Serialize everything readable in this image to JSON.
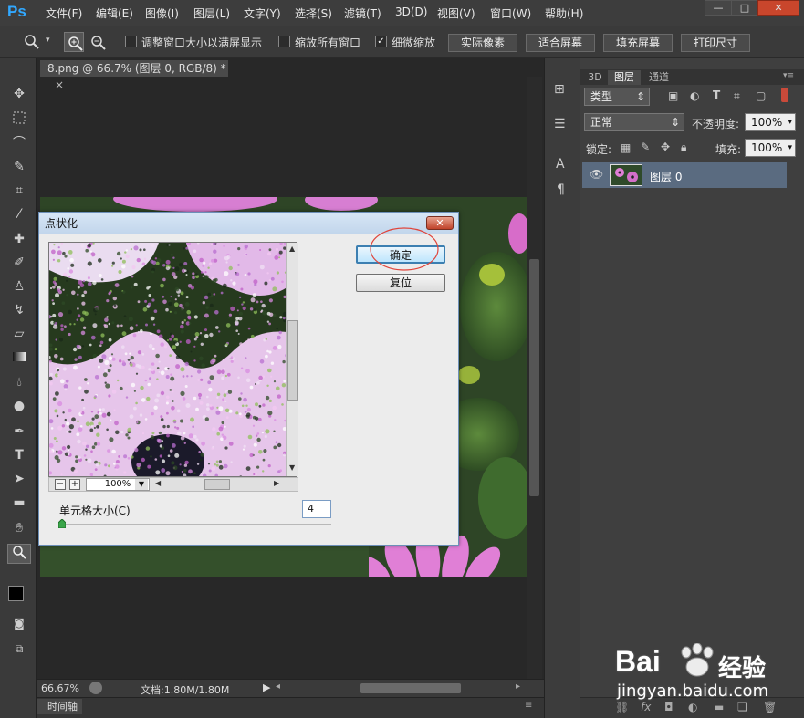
{
  "app": {
    "logo": "Ps"
  },
  "menu": [
    "文件(F)",
    "编辑(E)",
    "图像(I)",
    "图层(L)",
    "文字(Y)",
    "选择(S)",
    "滤镜(T)",
    "3D(D)",
    "视图(V)",
    "窗口(W)",
    "帮助(H)"
  ],
  "window_controls": {
    "minimize": "—",
    "maximize": "□",
    "close": "✕"
  },
  "options": {
    "cb_fit_window_label": "调整窗口大小以满屏显示",
    "cb_fit_window": false,
    "cb_zoom_all_label": "缩放所有窗口",
    "cb_zoom_all": false,
    "cb_scrubby_label": "细微缩放",
    "cb_scrubby": true,
    "btn_actual": "实际像素",
    "btn_fit": "适合屏幕",
    "btn_fill": "填充屏幕",
    "btn_print": "打印尺寸"
  },
  "document": {
    "tab_title": "8.png @ 66.7% (图层 0, RGB/8) *",
    "tab_close": "×"
  },
  "status": {
    "zoom": "66.67%",
    "doc_info": "文档:1.80M/1.80M"
  },
  "timeline": {
    "label": "时间轴"
  },
  "panel": {
    "tabs": [
      "3D",
      "图层",
      "通道"
    ],
    "filter_kind": "类型",
    "blend_mode": "正常",
    "opacity_label": "不透明度:",
    "opacity": "100%",
    "lock_label": "锁定:",
    "fill_label": "填充:",
    "fill": "100%",
    "layer_name": "图层 0"
  },
  "dialog": {
    "title": "点状化",
    "ok": "确定",
    "reset": "复位",
    "zoom": "100%",
    "cell_size_label": "单元格大小(C)",
    "cell_size": "4",
    "slider_fraction": 0.0
  },
  "watermark": {
    "brand": "Bai",
    "brand2": "经验",
    "url": "jingyan.baidu.com"
  }
}
